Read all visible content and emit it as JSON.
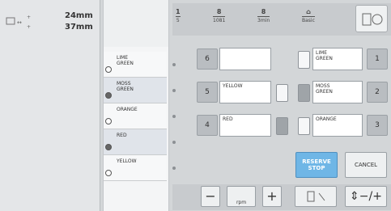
{
  "left_panel": {
    "size": {
      "width": "24mm",
      "height": "37mm"
    }
  },
  "color_list": {
    "items": [
      {
        "label": "LIME\nGREEN",
        "selected": false
      },
      {
        "label": "MOSS\nGREEN",
        "selected": true
      },
      {
        "label": "ORANGE",
        "selected": false
      },
      {
        "label": "RED",
        "selected": true
      },
      {
        "label": "YELLOW",
        "selected": false
      }
    ]
  },
  "top_bar": {
    "stitch_current": "1",
    "stitch_total": "5",
    "color_current": "8",
    "color_total": "1081",
    "time_current": "8",
    "time_total": "3min",
    "mode_label": "Basic"
  },
  "spools": [
    {
      "slot": "6",
      "label": "",
      "toggle": "light"
    },
    {
      "slot": "5",
      "label": "YELLOW",
      "toggle": "light"
    },
    {
      "slot": "4",
      "label": "RED",
      "toggle": "dark"
    },
    {
      "slot": "1",
      "label": "LIME\nGREEN",
      "toggle": "light"
    },
    {
      "slot": "2",
      "label": "MOSS\nGREEN",
      "toggle": "dark"
    },
    {
      "slot": "3",
      "label": "ORANGE",
      "toggle": "light"
    }
  ],
  "buttons": {
    "reserve_stop": "RESERVE\nSTOP",
    "cancel": "CANCEL",
    "speed_label": "rpm"
  }
}
